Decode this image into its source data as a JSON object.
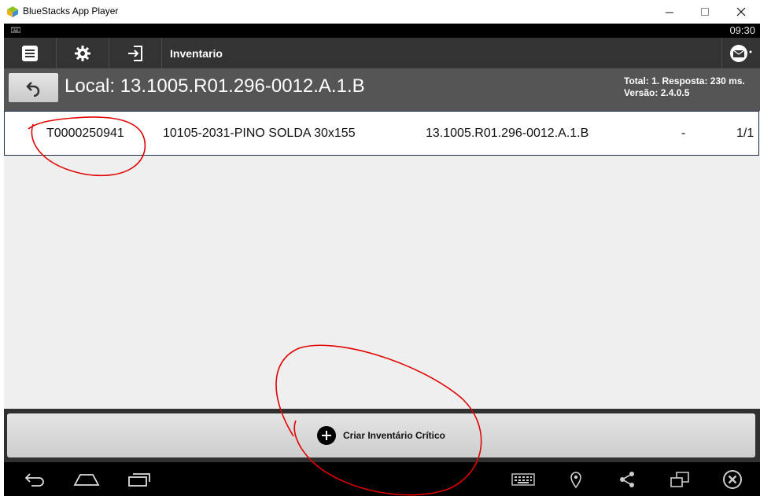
{
  "window": {
    "title": "BlueStacks App Player",
    "icons": {
      "app": "bluestacks-logo-icon",
      "minimize": "minimize-icon",
      "maximize": "maximize-icon",
      "close": "close-icon"
    }
  },
  "status_bar": {
    "time": "09:30",
    "icon": "keyboard-indicator-icon"
  },
  "action_bar": {
    "title": "Inventario",
    "icons": [
      "list-menu-icon",
      "gear-icon",
      "exit-icon",
      "mail-icon"
    ]
  },
  "header": {
    "local_label": "Local: 13.1005.R01.296-0012.A.1.B",
    "total_line": "Total: 1. Resposta: 230 ms.",
    "version_line": "Versão: 2.4.0.5",
    "back_icon": "undo-arrow-icon"
  },
  "results": [
    {
      "code": "T0000250941",
      "description": "10105-2031-PINO SOLDA 30x155",
      "location": "13.1005.R01.296-0012.A.1.B",
      "extra": "-",
      "count": "1/1"
    }
  ],
  "footer": {
    "create_label": "Criar Inventário Crítico",
    "create_icon": "plus-circle-icon"
  },
  "nav_bar": {
    "icons": [
      "back-icon",
      "home-icon",
      "recent-apps-icon",
      "keyboard-icon",
      "location-pin-icon",
      "share-icon",
      "screen-rotate-icon",
      "close-app-icon"
    ]
  },
  "colors": {
    "action_bar": "#333333",
    "header": "#555555",
    "annotation": "#e00000",
    "row_border": "#1c2f4a"
  }
}
